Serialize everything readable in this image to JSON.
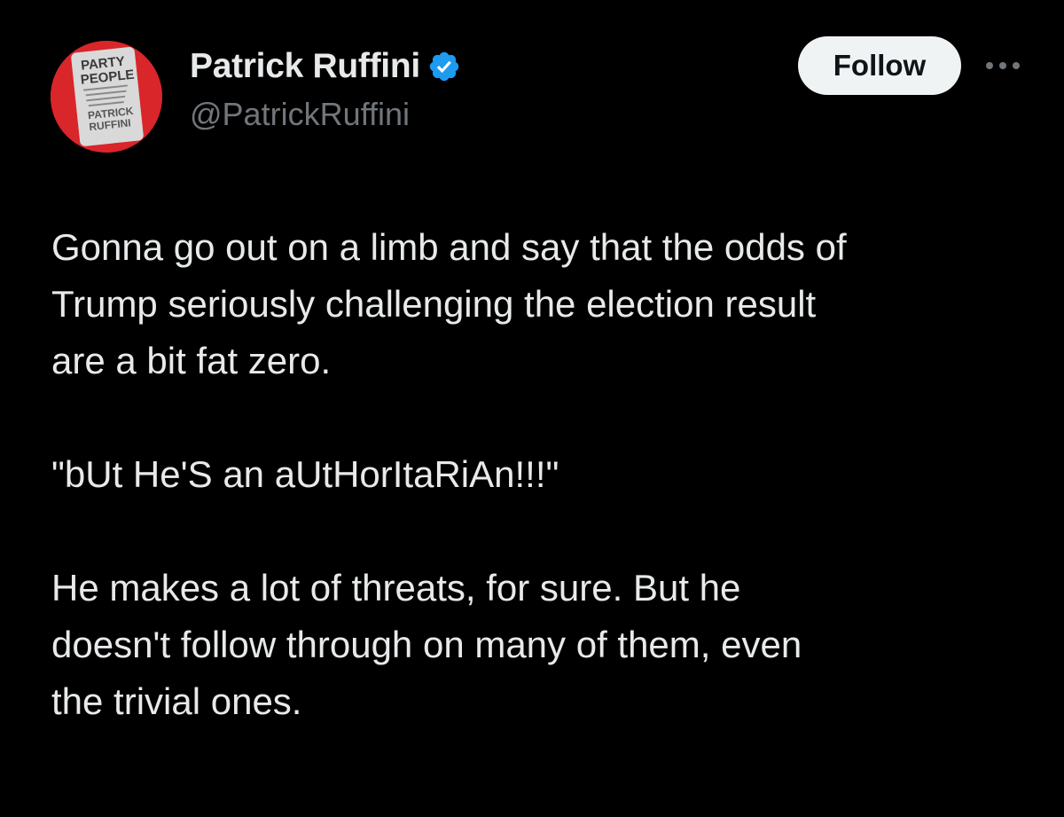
{
  "author": {
    "name": "Patrick Ruffini",
    "handle": "@PatrickRuffini",
    "verified": true,
    "avatar_icon": "book-cover-party-people-avatar",
    "avatar_text": {
      "line1": "PARTY",
      "line2": "PEOPLE",
      "line3": "PATRICK",
      "line4": "RUFFINI"
    }
  },
  "actions": {
    "follow_label": "Follow",
    "more_icon": "more-horizontal-icon"
  },
  "tweet": {
    "paragraphs": [
      "Gonna go out on a limb and say that the odds of\nTrump seriously challenging the election result\nare a bit fat zero.",
      "\"bUt He'S an aUtHorItaRiAn!!!\"",
      "He makes a lot of threats, for sure. But he\ndoesn't follow through on many of them, even\nthe trivial ones."
    ]
  },
  "colors": {
    "background": "#000000",
    "text_primary": "#e7e9ea",
    "text_secondary": "#71767b",
    "verified_badge": "#1d9bf0",
    "follow_button_bg": "#eff3f4",
    "follow_button_text": "#0f1419",
    "avatar_ring": "#d8262b"
  }
}
